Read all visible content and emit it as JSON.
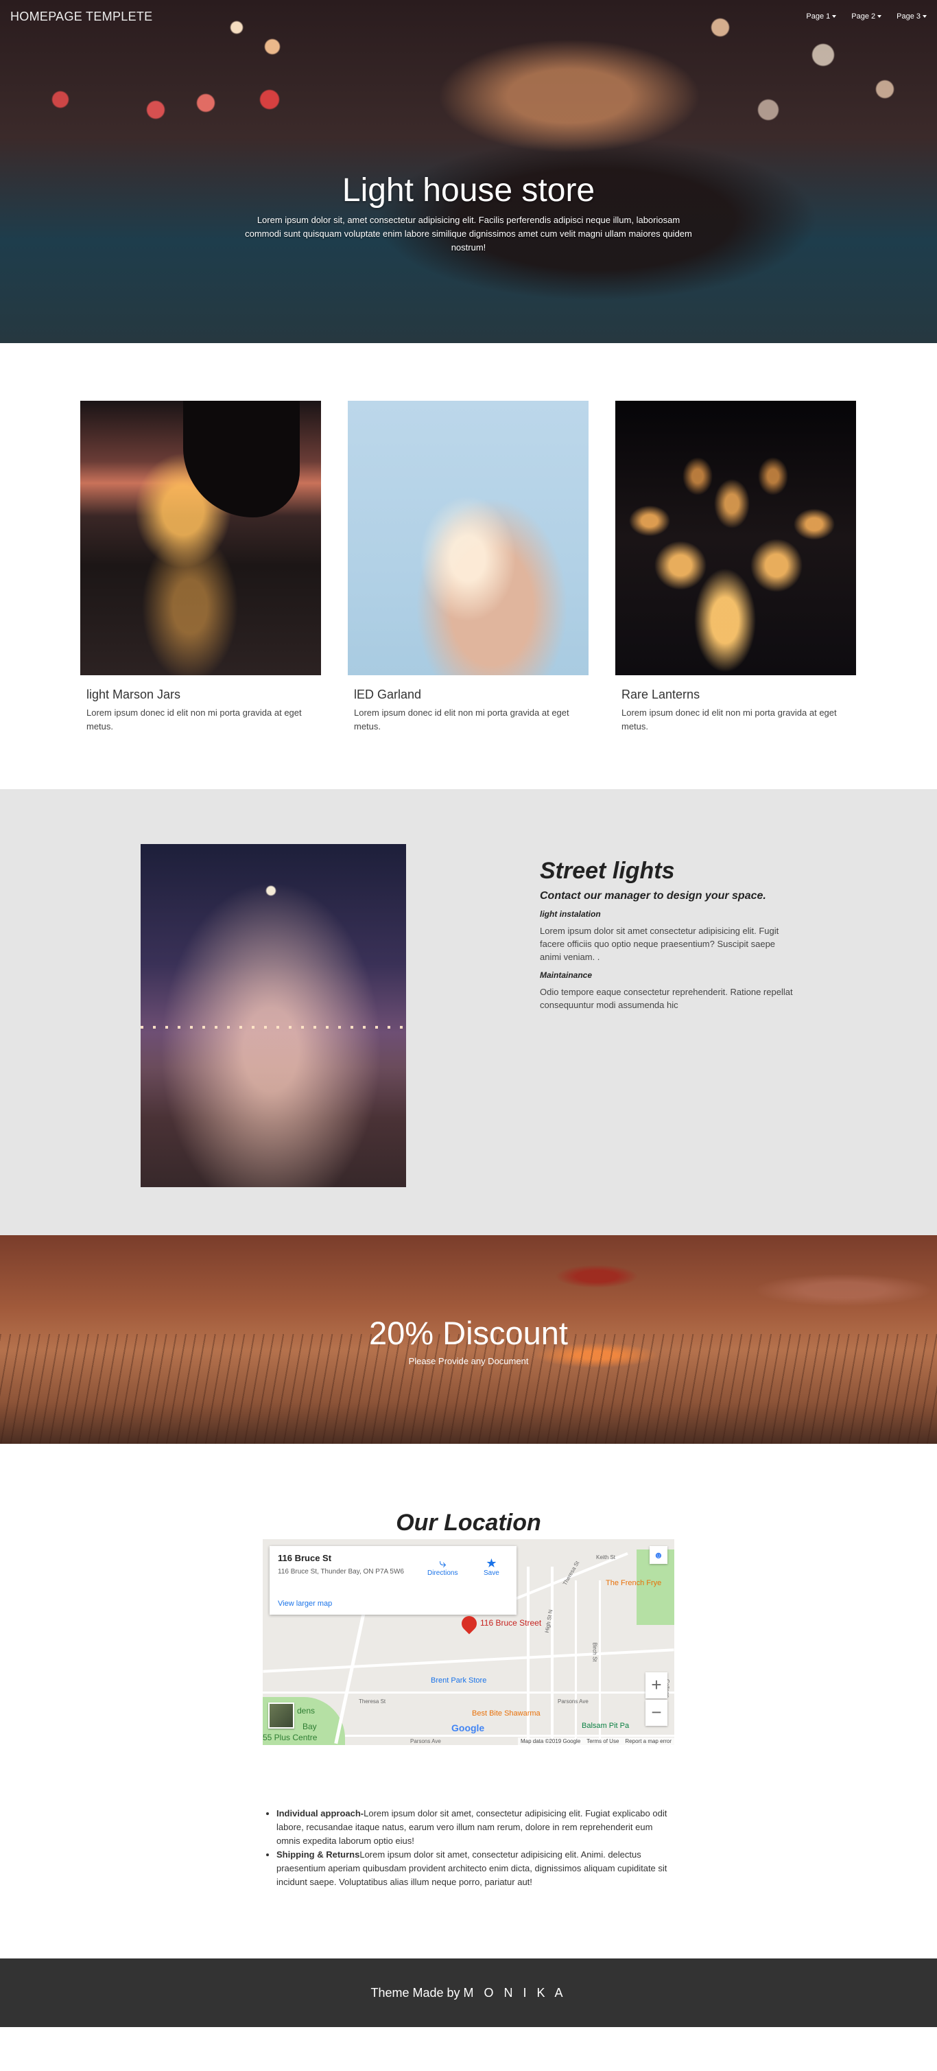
{
  "nav": {
    "brand": "HOMEPAGE TEMPLETE",
    "links": [
      "Page 1",
      "Page 2",
      "Page 3"
    ]
  },
  "hero": {
    "title": "Light house store",
    "subtitle": "Lorem ipsum dolor sit, amet consectetur adipisicing elit. Facilis perferendis adipisci neque illum, laboriosam commodi sunt quisquam voluptate enim labore similique dignissimos amet cum velit magni ullam maiores quidem nostrum!"
  },
  "products": [
    {
      "name": "light Marson Jars",
      "desc": "Lorem ipsum donec id elit non mi porta gravida at eget metus."
    },
    {
      "name": "lED Garland",
      "desc": "Lorem ipsum donec id elit non mi porta gravida at eget metus."
    },
    {
      "name": "Rare Lanterns",
      "desc": "Lorem ipsum donec id elit non mi porta gravida at eget metus."
    }
  ],
  "street": {
    "title": "Street lights",
    "tagline": "Contact our manager to design your space.",
    "heading1": "light instalation",
    "para1": "Lorem ipsum dolor sit amet consectetur adipisicing elit. Fugit facere officiis quo optio neque praesentium? Suscipit saepe animi veniam. .",
    "heading2": "Maintainance",
    "para2": "Odio tempore eaque consectetur reprehenderit. Ratione repellat consequuntur modi assumenda hic"
  },
  "discount": {
    "title": "20% Discount",
    "subtitle": "Please Provide any Document"
  },
  "location": {
    "title": "Our Location",
    "map": {
      "card_title": "116 Bruce St",
      "card_address": "116 Bruce St, Thunder Bay, ON P7A 5W6",
      "directions": "Directions",
      "save": "Save",
      "larger_map": "View larger map",
      "pin_label": "116 Bruce Street",
      "poi_park": "Brent Park Store",
      "poi_food": "Best Bite Shawarma",
      "poi_french": "The French Frye",
      "poi_balsam": "Balsam Pit Pa",
      "street_theresa": "Theresa St",
      "street_theresa2": "Theresa St",
      "street_keith": "Keith St",
      "street_parsons": "Parsons Ave",
      "street_parsons2": "Parsons Ave",
      "street_high": "High St N",
      "street_college": "College St",
      "street_birch": "Birch St",
      "partial_dens": "dens",
      "partial_bay": "Bay",
      "partial_centre": "55 Plus Centre",
      "google": "Google",
      "map_data": "Map data ©2019 Google",
      "terms": "Terms of Use",
      "report": "Report a map error",
      "zoom_in": "+",
      "zoom_out": "−"
    }
  },
  "info": [
    {
      "label": "Individual approach-",
      "text": "Lorem ipsum dolor sit amet, consectetur adipisicing elit. Fugiat explicabo odit labore, recusandae itaque natus, earum vero illum nam rerum, dolore in rem reprehenderit eum omnis expedita laborum optio eius!"
    },
    {
      "label": "Shipping & Returns",
      "text": "Lorem ipsum dolor sit amet, consectetur adipisicing elit. Animi. delectus praesentium aperiam quibusdam provident architecto enim dicta, dignissimos aliquam cupiditate sit incidunt saepe. Voluptatibus alias illum neque porro, pariatur aut!"
    }
  ],
  "footer": {
    "prefix": "Theme Made by ",
    "author": "M O N I K A"
  },
  "icons": {
    "directions": "directions-icon",
    "save": "star-icon",
    "caret": "caret-down-icon"
  }
}
